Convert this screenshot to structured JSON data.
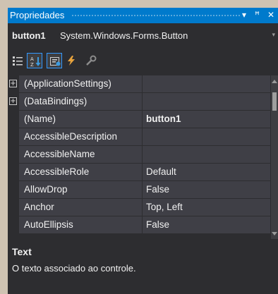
{
  "window": {
    "title": "Propriedades",
    "dropdown_glyph": "▾",
    "pin_glyph": "ꟸ",
    "close_glyph": "✕"
  },
  "object_selector": {
    "name": "button1",
    "type": "System.Windows.Forms.Button",
    "dropdown_glyph": "▾"
  },
  "toolbar": {
    "buttons": [
      {
        "icon": "categorized-icon",
        "active": false
      },
      {
        "icon": "alphabetical-icon",
        "active": true
      },
      {
        "icon": "properties-icon",
        "active": true
      },
      {
        "icon": "events-icon",
        "active": false
      },
      {
        "icon": "property-pages-icon",
        "active": false
      }
    ]
  },
  "grid": {
    "rows": [
      {
        "name": "(ApplicationSettings)",
        "value": "",
        "expandable": true,
        "bold": false
      },
      {
        "name": "(DataBindings)",
        "value": "",
        "expandable": true,
        "bold": false
      },
      {
        "name": "(Name)",
        "value": "button1",
        "expandable": false,
        "bold": true
      },
      {
        "name": "AccessibleDescription",
        "value": "",
        "expandable": false,
        "bold": false
      },
      {
        "name": "AccessibleName",
        "value": "",
        "expandable": false,
        "bold": false
      },
      {
        "name": "AccessibleRole",
        "value": "Default",
        "expandable": false,
        "bold": false
      },
      {
        "name": "AllowDrop",
        "value": "False",
        "expandable": false,
        "bold": false
      },
      {
        "name": "Anchor",
        "value": "Top, Left",
        "expandable": false,
        "bold": false
      },
      {
        "name": "AutoEllipsis",
        "value": "False",
        "expandable": false,
        "bold": false
      }
    ],
    "expander_glyph": "+"
  },
  "description": {
    "title": "Text",
    "text": "O texto associado ao controle."
  },
  "colors": {
    "accent": "#007acc",
    "panel": "#2d2d30",
    "cell": "#3f3f46",
    "text": "#f1f1f1",
    "events_icon": "#e8a33d"
  }
}
